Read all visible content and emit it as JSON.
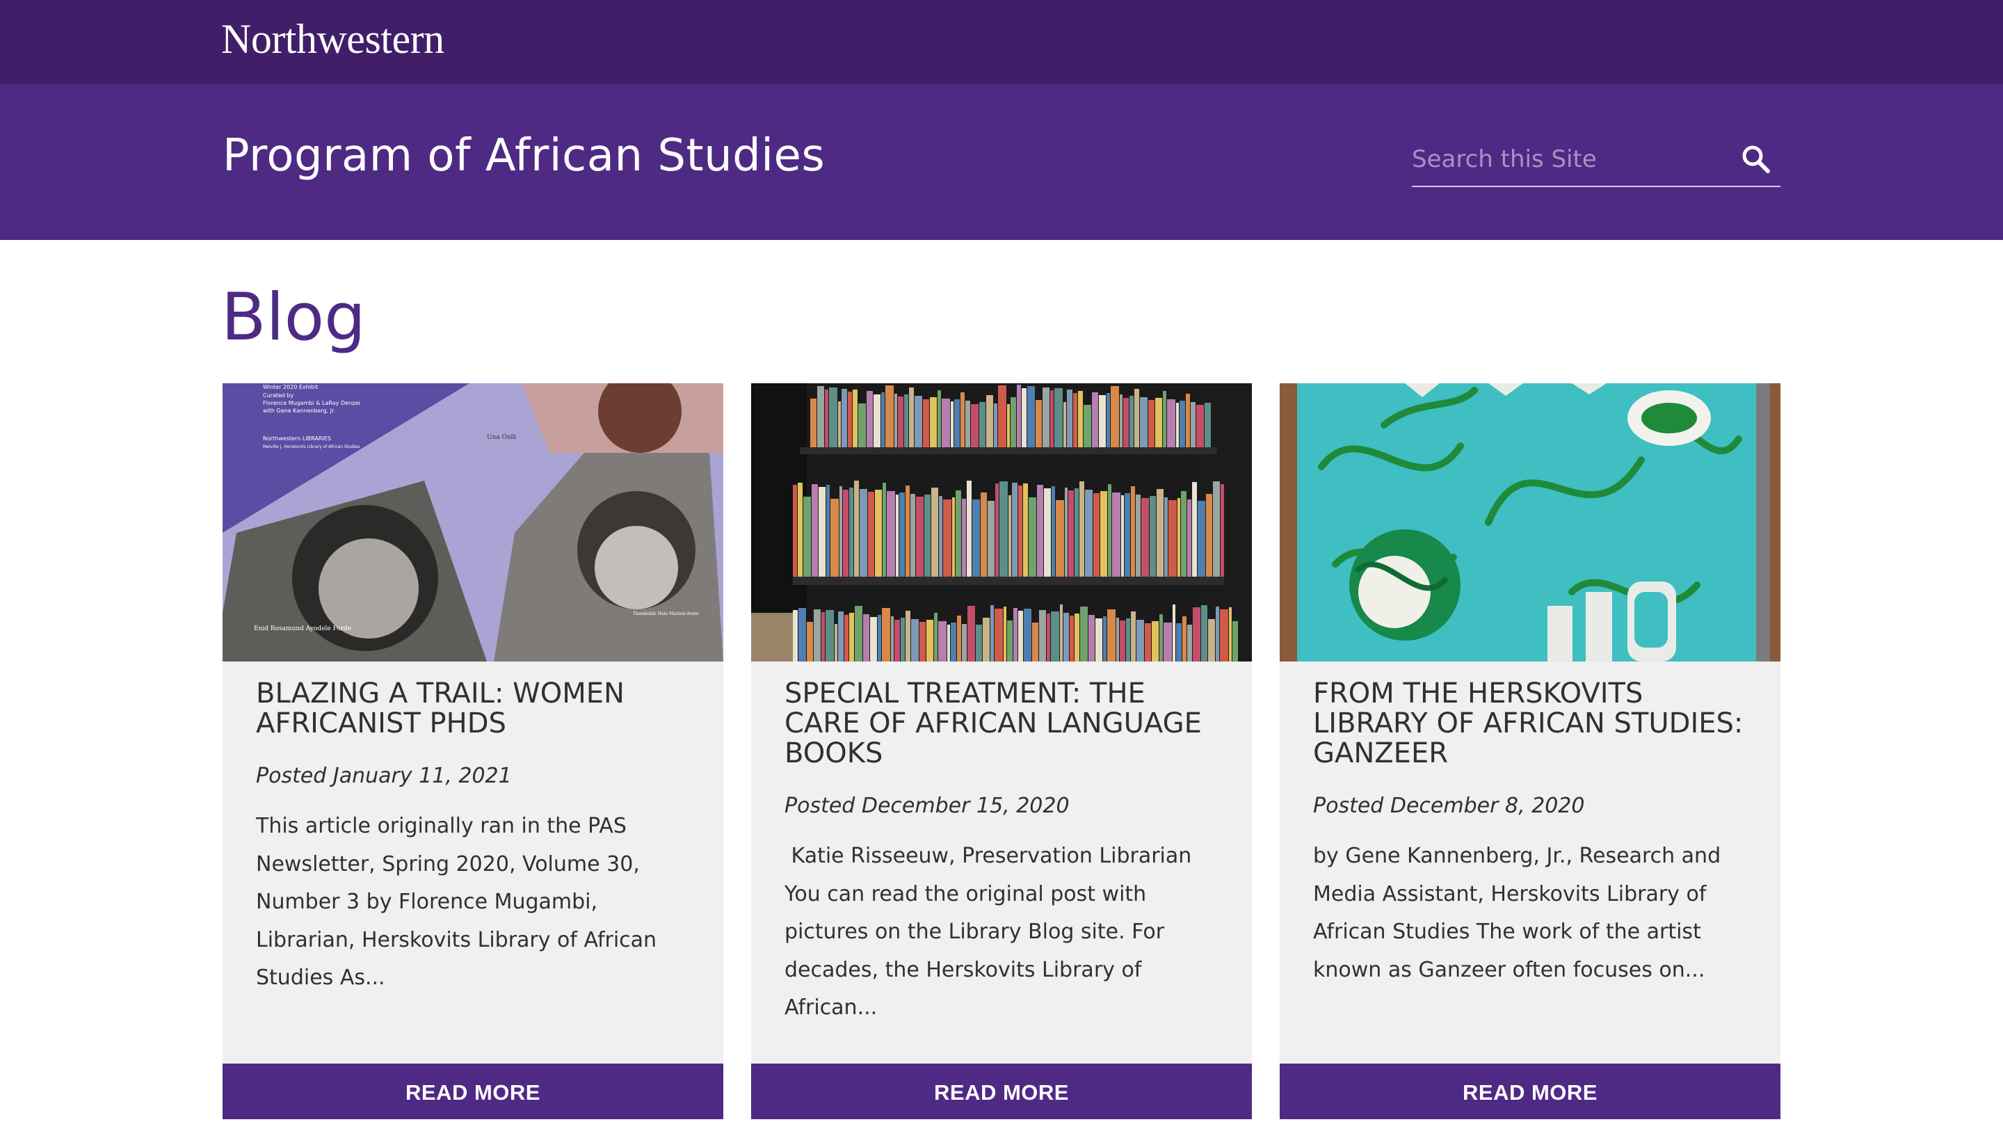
{
  "header": {
    "logo": "Northwestern",
    "site_title": "Program of African Studies",
    "search_placeholder": "Search this Site"
  },
  "page": {
    "heading": "Blog"
  },
  "posts": [
    {
      "title": "BLAZING A TRAIL: WOMEN AFRICANIST PHDS",
      "date": "Posted January 11, 2021",
      "excerpt": "This article originally ran in the PAS Newsletter, Spring 2020, Volume 30, Number 3 by Florence Mugambi, Librarian, Herskovits Library of African Studies As...",
      "read_more": "READ MORE",
      "image_text": {
        "exhibit": "Winter 2020 Exhibit",
        "curated": "Curated by",
        "curators": "Florence Mugambi & LaRay Denzer",
        "with": "with Gene Kannenberg, Jr.",
        "library": "Northwestern LIBRARIES",
        "library_sub": "Melville J. Herskovits Library of African Studies",
        "caption_1": "Una Osili",
        "caption_2": "Enid Rosamund Ayodele Forde",
        "caption_3": "Thandekile Hala Mazwai-Avani"
      }
    },
    {
      "title": "SPECIAL TREATMENT: THE CARE OF AFRICAN LANGUAGE BOOKS",
      "date": "Posted December 15, 2020",
      "excerpt": " Katie Risseeuw, Preservation Librarian You can read the original post with pictures on the Library Blog site. For decades, the Herskovits Library of African...",
      "read_more": "READ MORE"
    },
    {
      "title": "FROM THE HERSKOVITS LIBRARY OF AFRICAN STUDIES: GANZEER",
      "date": "Posted December 8, 2020",
      "excerpt": "by Gene Kannenberg, Jr., Research and Media Assistant, Herskovits Library of African Studies The work of the artist known as Ganzeer often focuses on...",
      "read_more": "READ MORE"
    }
  ],
  "colors": {
    "top_bar": "#401f68",
    "brand_purple": "#4e2a84",
    "card_bg": "#f0f0f0",
    "text": "#342f2e"
  },
  "icons": {
    "search": "magnifier-icon"
  }
}
